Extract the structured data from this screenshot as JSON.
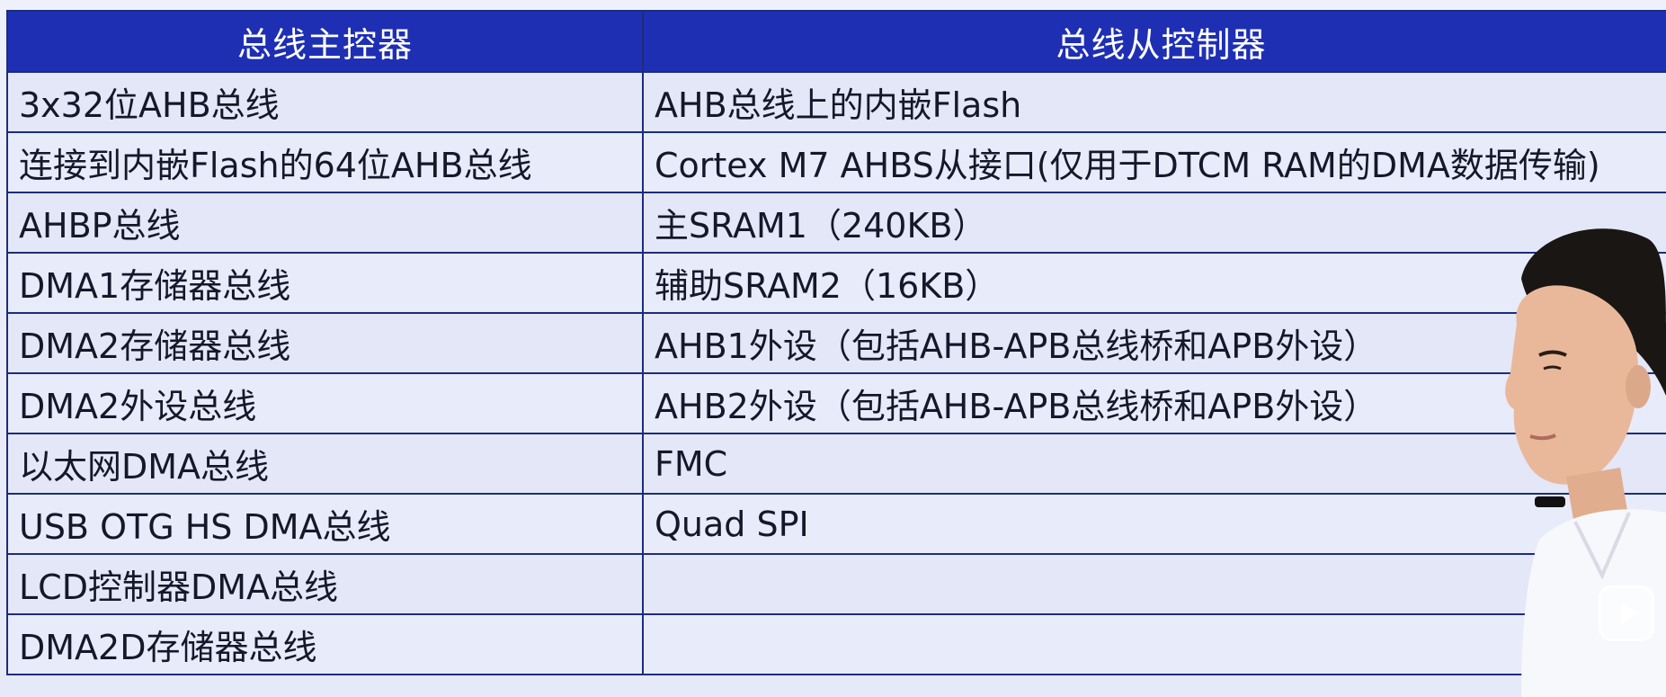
{
  "table": {
    "headers": [
      "总线主控器",
      "总线从控制器"
    ],
    "rows": [
      [
        "3x32位AHB总线",
        "AHB总线上的内嵌Flash"
      ],
      [
        "连接到内嵌Flash的64位AHB总线",
        "Cortex M7 AHBS从接口(仅用于DTCM RAM的DMA数据传输)"
      ],
      [
        "AHBP总线",
        "主SRAM1（240KB）"
      ],
      [
        "DMA1存储器总线",
        "辅助SRAM2（16KB）"
      ],
      [
        "DMA2存储器总线",
        "AHB1外设（包括AHB-APB总线桥和APB外设）"
      ],
      [
        "DMA2外设总线",
        "AHB2外设（包括AHB-APB总线桥和APB外设）"
      ],
      [
        "以太网DMA总线",
        "FMC"
      ],
      [
        "USB OTG HS DMA总线",
        "Quad SPI"
      ],
      [
        "LCD控制器DMA总线",
        ""
      ],
      [
        "DMA2D存储器总线",
        ""
      ]
    ]
  },
  "colors": {
    "header_bg": "#1e2fb4",
    "header_text": "#ffffff",
    "cell_bg": "#e8ebf9",
    "border": "#1d2d7a"
  },
  "icons": {
    "play": "play-icon",
    "presenter": "presenter-figure"
  }
}
